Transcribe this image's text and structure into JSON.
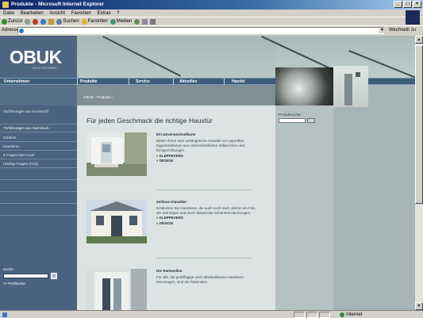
{
  "window": {
    "title": "Produkte - Microsoft Internet Explorer",
    "buttons": [
      "_",
      "□",
      "×"
    ]
  },
  "menu": {
    "items": [
      "Datei",
      "Bearbeiten",
      "Ansicht",
      "Favoriten",
      "Extras",
      "?"
    ]
  },
  "toolbar": {
    "back": "Zurück",
    "search": "Suchen",
    "favorites": "Favoriten",
    "media": "Medien"
  },
  "address": {
    "label": "Adresse",
    "value": "",
    "go": "Wechseln zu"
  },
  "status": {
    "text": "",
    "zone": "Internet"
  },
  "site": {
    "logo": "OBUK",
    "logo_sub": "HAUSTÜRFABRIK",
    "nav": [
      "Unternehmen",
      "Produkte",
      "Service",
      "Aktuelles",
      "Handel"
    ],
    "breadcrumb": "OBUK › Produkte ›",
    "sidebar": [
      "Türführungen aus Kunststoff",
      "Türführungen aus Aluminium",
      "Zubehör",
      "Haustüren",
      "5 Fragen beim Kauf",
      "Häufige Fragen (FAQ)"
    ],
    "search_label": "Suche",
    "search_value": "",
    "search_advanced": ">> Profisuche",
    "right_label": "Produktsuche",
    "right_value": "",
    "headline": "Für jeden Geschmack die richtige Haustür",
    "products": [
      {
        "name": "Ein Unverwechselbarer",
        "desc": "Bieten Ihnen eine umfangreiche Auswahl von geprüften Eigenkreationen aus unterschiedlichen Stilepochen und Designrichtungen.",
        "links": [
          "» KLEPPEVERS",
          "» DESIGN"
        ]
      },
      {
        "name": "Zeitlose Klassiker",
        "desc": "Entdecken Sie Haustüren, die auch noch nach Jahren ein Fels der Zeit liegen und durch klassische Schönheit überzeugen.",
        "links": [
          "» KLEPPEVERS",
          "» DESIGN"
        ]
      },
      {
        "name": "Die Rationellen",
        "desc": "Für alle, die großflügige und individualisierte Haustüren bevorzugen, sind die Rationalen",
        "links": []
      }
    ]
  },
  "colors": {
    "nav": "#3d5c7c",
    "sidebar": "#4b6380",
    "content": "#dde3e2",
    "accent": "#2a3540"
  }
}
